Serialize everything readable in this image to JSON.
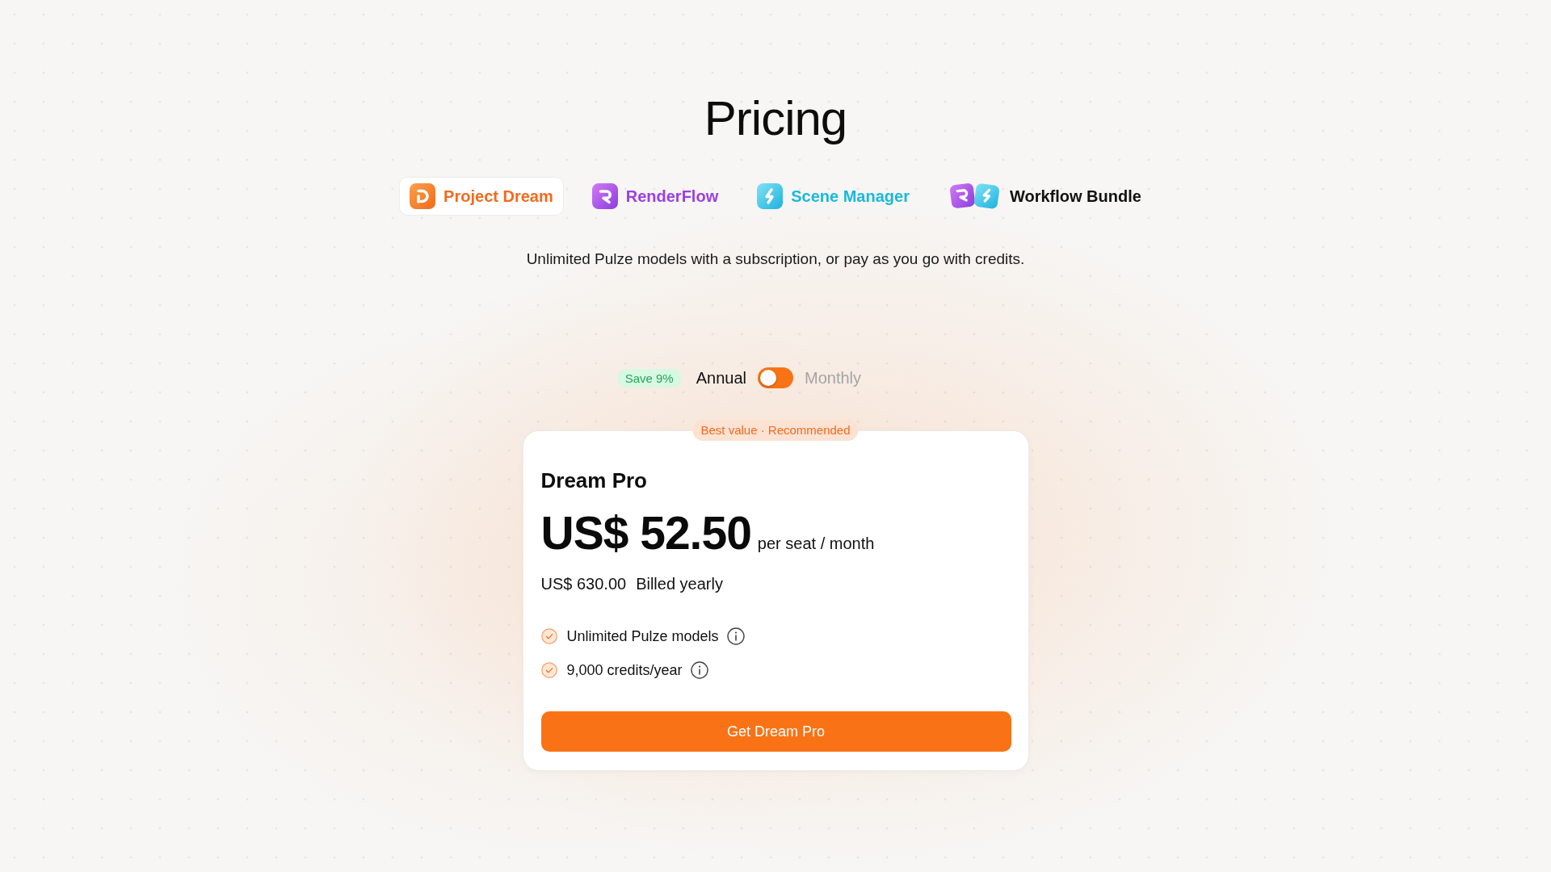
{
  "page": {
    "title": "Pricing",
    "subtitle": "Unlimited Pulze models with a subscription, or pay as you go with credits."
  },
  "tabs": [
    {
      "label": "Project Dream",
      "kind": "dream",
      "color": "#f26b1d",
      "selected": true
    },
    {
      "label": "RenderFlow",
      "kind": "render",
      "color": "#9b3fe3",
      "selected": false
    },
    {
      "label": "Scene Manager",
      "kind": "scene",
      "color": "#1ab8dd",
      "selected": false
    },
    {
      "label": "Workflow Bundle",
      "kind": "bundle",
      "color": "#111111",
      "selected": false
    }
  ],
  "billing": {
    "badge": "Save 9%",
    "options": [
      {
        "label": "Annual",
        "selected": true
      },
      {
        "label": "Monthly",
        "selected": false
      }
    ]
  },
  "plan": {
    "ribbon": "Best value · Recommended",
    "name": "Dream Pro",
    "price": "US$ 52.50",
    "price_unit": "per seat / month",
    "total": "US$ 630.00",
    "total_note": "Billed yearly",
    "features": [
      {
        "text": "Unlimited Pulze models",
        "info": true
      },
      {
        "text": "9,000 credits/year",
        "info": true
      }
    ],
    "button": "Get Dream Pro"
  }
}
